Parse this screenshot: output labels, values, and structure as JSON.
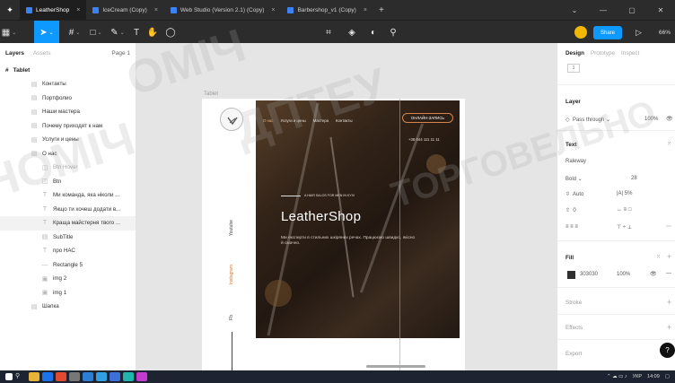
{
  "tabs": [
    {
      "label": "LeatherShop",
      "active": true
    },
    {
      "label": "IceCream (Copy)"
    },
    {
      "label": "Web Studio (Version 2.1) (Copy)"
    },
    {
      "label": "Barbershop_v1 (Copy)"
    }
  ],
  "toolbar": {
    "share": "Share",
    "zoom": "66%",
    "icons": [
      "menu-icon",
      "move-tool-icon",
      "frame-tool-icon",
      "shape-tool-icon",
      "pen-tool-icon",
      "text-tool-icon",
      "hand-tool-icon",
      "comment-icon",
      "component-icon",
      "asset-icon",
      "contrast-icon",
      "link-icon",
      "play-icon"
    ]
  },
  "left_panel": {
    "tab_layers": "Layers",
    "tab_assets": "Assets",
    "page": "Page 1",
    "frame_name": "Tablet",
    "layers": [
      {
        "label": "Контакты",
        "icon": "group-icon"
      },
      {
        "label": "Портфолио",
        "icon": "group-icon"
      },
      {
        "label": "Наши мастера",
        "icon": "group-icon"
      },
      {
        "label": "Почему приходят к нам",
        "icon": "group-icon"
      },
      {
        "label": "Услуги и цены",
        "icon": "group-icon"
      },
      {
        "label": "О нас",
        "icon": "group-icon"
      },
      {
        "label": "Btn Hover",
        "icon": "component-icon",
        "dim": true
      },
      {
        "label": "Btn",
        "icon": "component-icon"
      },
      {
        "label": "Ми команда, яка ніколи ...",
        "icon": "text-icon"
      },
      {
        "label": "Якщо ти хочеш додати в...",
        "icon": "text-icon"
      },
      {
        "label": "Краща майстерня твого ...",
        "icon": "text-icon",
        "selected": true
      },
      {
        "label": "SubTitle",
        "icon": "group-icon"
      },
      {
        "label": "про НАС",
        "icon": "text-icon"
      },
      {
        "label": "Rectangle 5",
        "icon": "line-icon"
      },
      {
        "label": "img 2",
        "icon": "image-icon"
      },
      {
        "label": "img 1",
        "icon": "image-icon"
      },
      {
        "label": "Шапка",
        "icon": "group-icon"
      }
    ]
  },
  "canvas": {
    "frame_label": "Tablet",
    "social": [
      "Youtube",
      "Instagram",
      "Fb"
    ],
    "hero": {
      "nav": [
        "О нас",
        "Услуги и цены",
        "Мастера",
        "Контакты"
      ],
      "cta": "ОНЛАЙН-ЗАПИСЬ",
      "phone": "+38 044 111 11 11",
      "kicker": "A HAIR SALOS FOR MEN IN KYIV",
      "title": "LeatherShop",
      "subtitle": "Ми експерти в стильних шкіряних речах. Працюємо швидко, якісно й смачно."
    }
  },
  "right_panel": {
    "tab_design": "Design",
    "tab_prototype": "Prototype",
    "tab_inspect": "Inspect",
    "zoom_value": "1",
    "layer_heading": "Layer",
    "blend": "Pass through",
    "opacity": "100%",
    "text_heading": "Text",
    "font": "Raleway",
    "weight": "Bold",
    "size": "28",
    "line_height": "Auto",
    "letter_spacing": "5%",
    "paragraph": "0",
    "fill_heading": "Fill",
    "fill_hex": "303030",
    "fill_opacity": "100%",
    "stroke_heading": "Stroke",
    "effects_heading": "Effects",
    "export_heading": "Export",
    "help": "?"
  },
  "taskbar": {
    "lang": "УКР",
    "time": "14:09"
  },
  "watermark": [
    "ОМІЧ",
    "ДПТЕУ",
    "НОМІЧ",
    "ТОРГОВЕЛЬНО"
  ],
  "colors": {
    "accent": "#0d99ff",
    "cta": "#d4854f",
    "fill": "#303030"
  }
}
